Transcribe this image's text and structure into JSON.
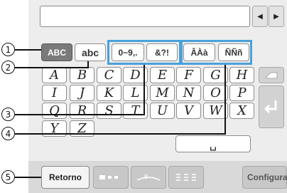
{
  "tabs": {
    "uppercase": "ABC",
    "lowercase": "abc",
    "numbers": "0~9,.",
    "symbols": "&?!",
    "accented_upper": "ÂÀà",
    "accented_n": "ÑÑñ"
  },
  "keys": {
    "row1": [
      "A",
      "B",
      "C",
      "D",
      "E",
      "F",
      "G",
      "H"
    ],
    "row2": [
      "I",
      "J",
      "K",
      "L",
      "M",
      "N",
      "O",
      "P"
    ],
    "row3": [
      "Q",
      "R",
      "S",
      "T",
      "U",
      "V",
      "W",
      "X"
    ],
    "row4": [
      "Y",
      "Z"
    ]
  },
  "space_symbol": "␣",
  "footer": {
    "back_label": "Retorno",
    "config_label": "Configurar"
  },
  "callouts": [
    "1",
    "2",
    "3",
    "4",
    "5"
  ],
  "colors": {
    "highlight": "#4aa1db",
    "active_tab": "#7a7a7a"
  }
}
